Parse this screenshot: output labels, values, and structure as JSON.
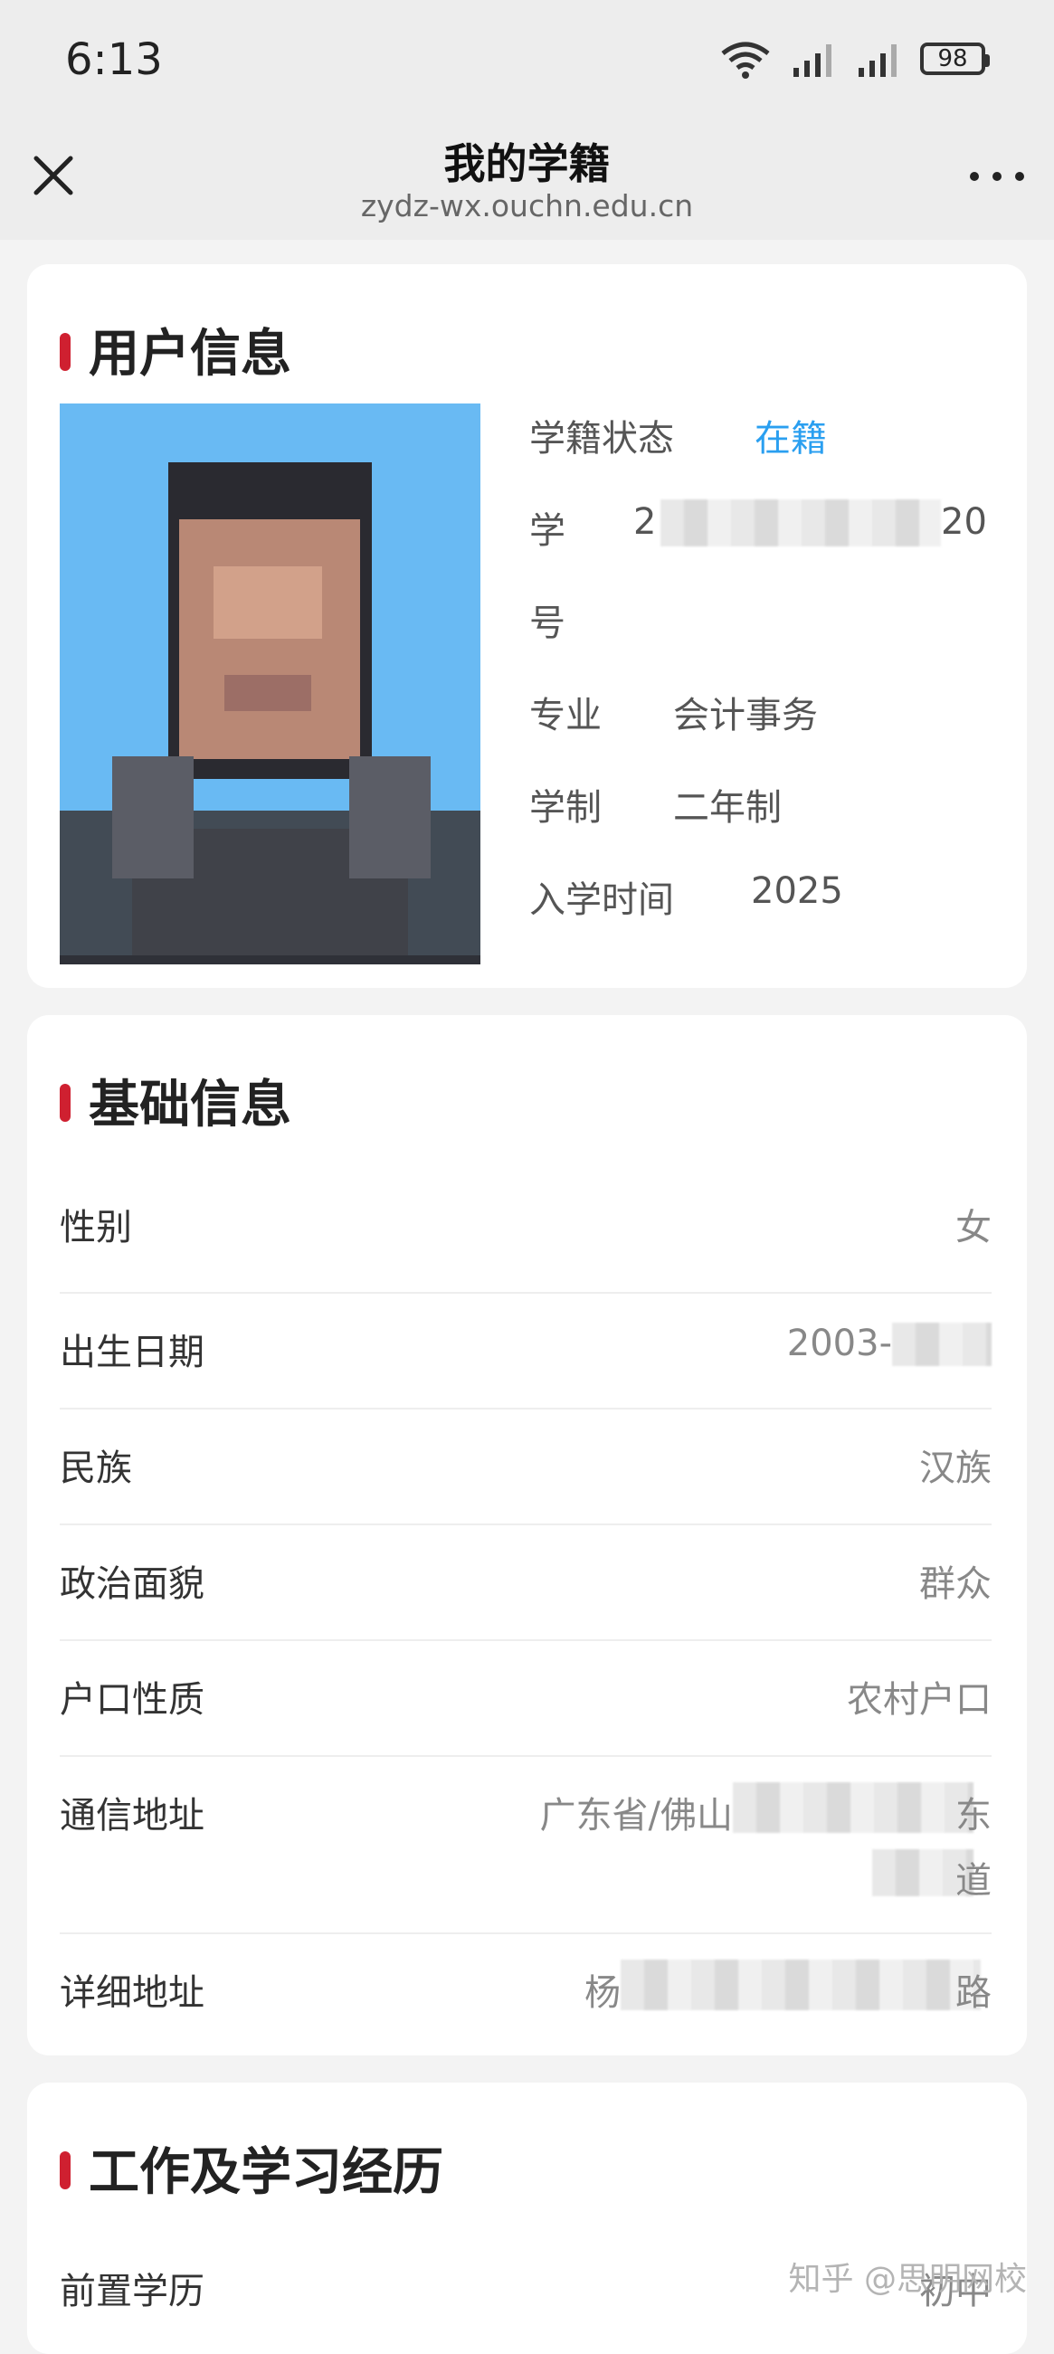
{
  "status_bar": {
    "time": "6:13",
    "battery": "98",
    "icons": [
      "wifi-icon",
      "signal-icon",
      "signal-icon",
      "battery-icon"
    ]
  },
  "nav": {
    "title": "我的学籍",
    "url": "zydz-wx.ouchn.edu.cn",
    "close_icon": "close-icon",
    "more_icon": "more-icon"
  },
  "user_info": {
    "title": "用户信息",
    "rows": [
      {
        "label": "学籍状态",
        "value": "在籍"
      },
      {
        "label": "学",
        "value_prefix": "2",
        "value_suffix": "20"
      },
      {
        "label": "号"
      },
      {
        "label": "专业",
        "value": "会计事务"
      },
      {
        "label": "学制",
        "value": "二年制"
      },
      {
        "label": "入学时间",
        "value": "2025"
      }
    ]
  },
  "basic_info": {
    "title": "基础信息",
    "rows": [
      {
        "label": "性别",
        "value": "女"
      },
      {
        "label": "出生日期",
        "value": "2003-"
      },
      {
        "label": "民族",
        "value": "汉族"
      },
      {
        "label": "政治面貌",
        "value": "群众"
      },
      {
        "label": "户口性质",
        "value": "农村户口"
      },
      {
        "label": "通信地址",
        "value": "广东省/佛山",
        "value_tail": "东",
        "value_line2_tail": "道"
      },
      {
        "label": "详细地址",
        "value": "杨",
        "value_tail": "路"
      }
    ]
  },
  "work_study": {
    "title": "工作及学习经历",
    "rows": [
      {
        "label": "前置学历",
        "value": "初中"
      }
    ]
  },
  "watermark": "知乎 @思明网校",
  "colors": {
    "accent_red": "#cf2030",
    "status_blue": "#2a9ff0",
    "background": "#f3f3f3"
  }
}
